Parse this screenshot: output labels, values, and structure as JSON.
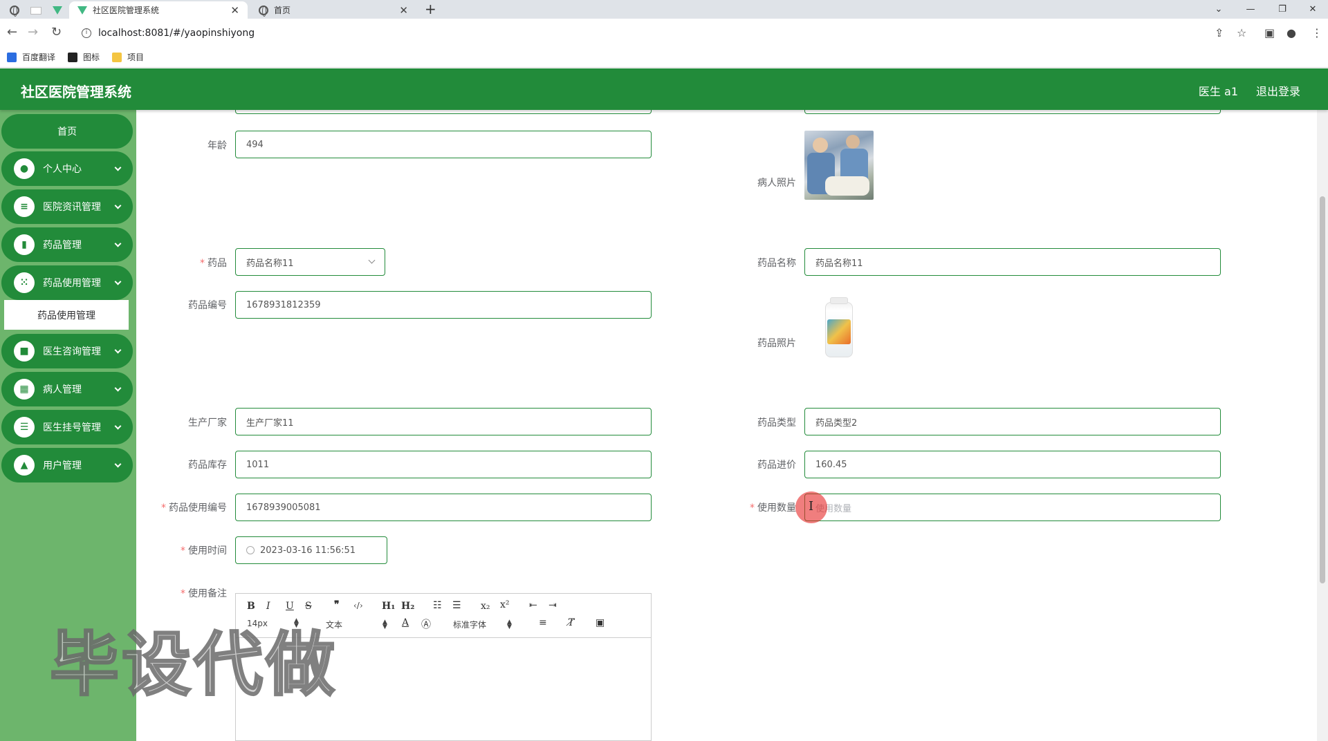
{
  "browser": {
    "tabs": [
      {
        "title": "社区医院管理系统",
        "active": true
      },
      {
        "title": "首页",
        "active": false
      }
    ],
    "url": "localhost:8081/#/yaopinshiyong",
    "bookmarks": [
      "百度翻译",
      "图标",
      "项目"
    ],
    "window_controls": {
      "minimize": "—",
      "restore": "❐",
      "close": "✕"
    }
  },
  "header": {
    "title": "社区医院管理系统",
    "user": "医生 a1",
    "logout": "退出登录",
    "color": "#228b3a"
  },
  "sidebar": {
    "home": "首页",
    "items": [
      {
        "label": "个人中心",
        "icon": "person-icon"
      },
      {
        "label": "医院资讯管理",
        "icon": "sliders-icon"
      },
      {
        "label": "药品管理",
        "icon": "bar-chart-icon"
      },
      {
        "label": "药品使用管理",
        "icon": "grid-icon"
      },
      {
        "label": "医生咨询管理",
        "icon": "briefcase-icon"
      },
      {
        "label": "病人管理",
        "icon": "apps-icon"
      },
      {
        "label": "医生挂号管理",
        "icon": "list-icon"
      },
      {
        "label": "用户管理",
        "icon": "user-icon"
      }
    ],
    "active_sub": "药品使用管理"
  },
  "form": {
    "age": {
      "label": "年龄",
      "value": "494"
    },
    "patient_photo": {
      "label": "病人照片"
    },
    "drug": {
      "label": "药品",
      "value": "药品名称11"
    },
    "drug_name": {
      "label": "药品名称",
      "value": "药品名称11"
    },
    "drug_code": {
      "label": "药品编号",
      "value": "1678931812359"
    },
    "drug_photo": {
      "label": "药品照片"
    },
    "manufacturer": {
      "label": "生产厂家",
      "value": "生产厂家11"
    },
    "drug_type": {
      "label": "药品类型",
      "value": "药品类型2"
    },
    "stock": {
      "label": "药品库存",
      "value": "1011"
    },
    "price": {
      "label": "药品进价",
      "value": "160.45"
    },
    "usage_code": {
      "label": "药品使用编号",
      "value": "1678939005081"
    },
    "quantity": {
      "label": "使用数量",
      "placeholder": "使用数量"
    },
    "usage_time": {
      "label": "使用时间",
      "value": "2023-03-16 11:56:51"
    },
    "remark": {
      "label": "使用备注"
    }
  },
  "editor": {
    "font_size": "14px",
    "text_type": "文本",
    "font_family": "标准字体"
  },
  "watermark": "毕设代做"
}
